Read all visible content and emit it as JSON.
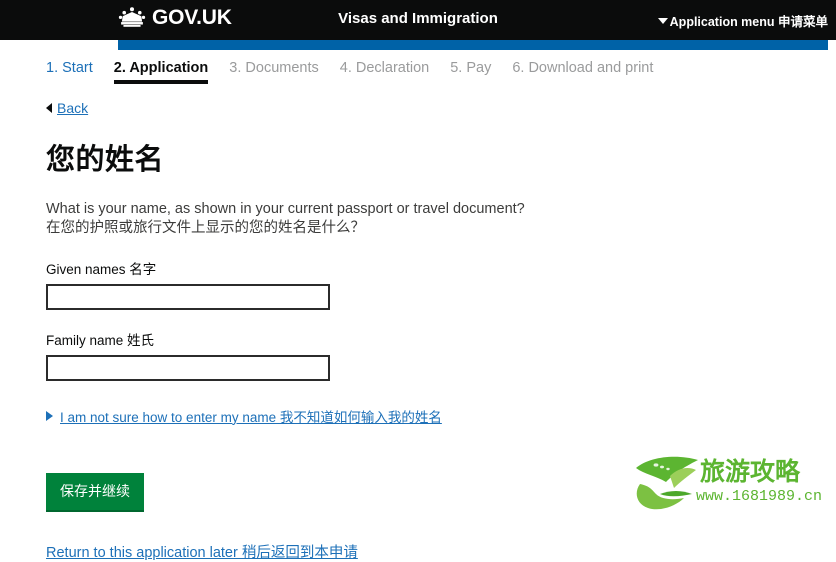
{
  "header": {
    "logo_text": "GOV.UK",
    "crown_icon": "crown-icon",
    "service_title": "Visas and Immigration",
    "app_menu_label": "Application menu 申请菜单",
    "menu_caret_icon": "caret-down-icon",
    "bar_color": "#0062a7",
    "background_color": "#0b0c0c"
  },
  "steps": [
    {
      "label": "1. Start",
      "state": "link"
    },
    {
      "label": "2. Application",
      "state": "active"
    },
    {
      "label": "3. Documents",
      "state": "muted"
    },
    {
      "label": "4. Declaration",
      "state": "muted"
    },
    {
      "label": "5. Pay",
      "state": "muted"
    },
    {
      "label": "6. Download and print",
      "state": "muted"
    }
  ],
  "back": {
    "label": "Back",
    "caret_icon": "caret-left-icon"
  },
  "main": {
    "page_title": "您的姓名",
    "question_en": "What is your name, as shown in your current passport or travel document?",
    "question_cn": "在您的护照或旅行文件上显示的您的姓名是什么？",
    "fields": [
      {
        "label": "Given names 名字",
        "value": "",
        "placeholder": "",
        "name": "given-names"
      },
      {
        "label": "Family name 姓氏",
        "value": "",
        "placeholder": "",
        "name": "family-name"
      }
    ],
    "details_label": "I am not sure how to enter my name 我不知道如何输入我的姓名",
    "details_caret_icon": "caret-right-icon",
    "submit_label": "保存并继续",
    "submit_color": "#00823b",
    "return_link_label": "Return to this application later 稍后返回到本申请"
  },
  "watermark": {
    "title": "旅游攻略",
    "url": "www.1681989.cn",
    "color": "#4caf1e"
  }
}
